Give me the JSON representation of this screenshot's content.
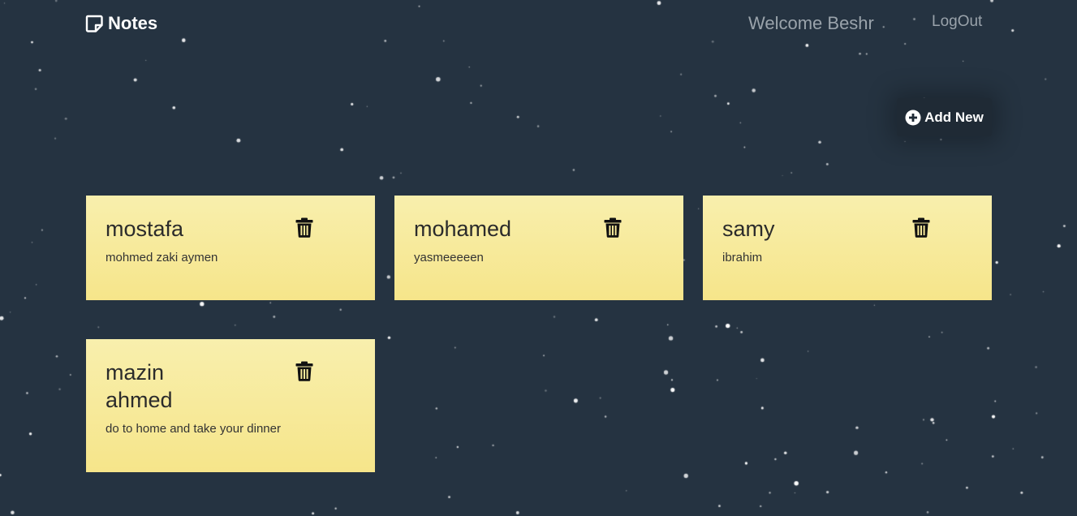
{
  "navbar": {
    "brand": "Notes",
    "welcome": "Welcome Beshr",
    "logout": "LogOut"
  },
  "actions": {
    "add_new_label": "Add New"
  },
  "notes": [
    {
      "title": "mostafa",
      "body": "mohmed zaki aymen"
    },
    {
      "title": "mohamed",
      "body": "yasmeeeeen"
    },
    {
      "title": "samy",
      "body": "ibrahim"
    },
    {
      "title": "mazin ahmed",
      "body": "do to home and take your dinner"
    }
  ],
  "colors": {
    "background": "#253341",
    "note_top": "#f8efad",
    "note_bottom": "#f6e58a",
    "nav_text": "#9aa3ab"
  },
  "icons": {
    "brand": "sticky-note-icon",
    "add": "plus-circle-icon",
    "delete": "trash-icon"
  }
}
